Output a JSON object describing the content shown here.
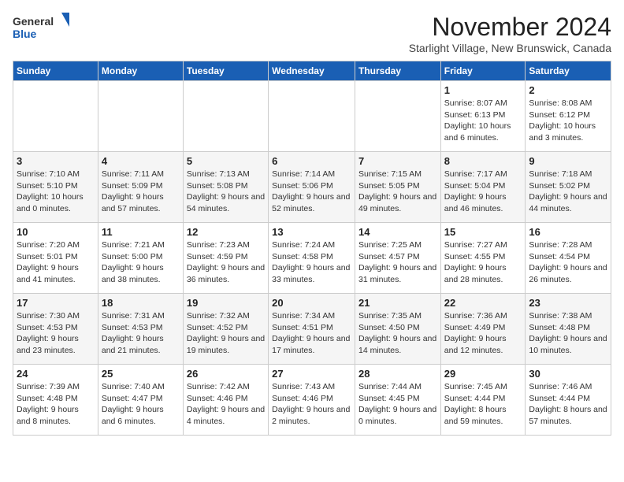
{
  "logo": {
    "line1": "General",
    "line2": "Blue"
  },
  "title": "November 2024",
  "subtitle": "Starlight Village, New Brunswick, Canada",
  "days_of_week": [
    "Sunday",
    "Monday",
    "Tuesday",
    "Wednesday",
    "Thursday",
    "Friday",
    "Saturday"
  ],
  "weeks": [
    [
      {
        "day": "",
        "detail": ""
      },
      {
        "day": "",
        "detail": ""
      },
      {
        "day": "",
        "detail": ""
      },
      {
        "day": "",
        "detail": ""
      },
      {
        "day": "",
        "detail": ""
      },
      {
        "day": "1",
        "detail": "Sunrise: 8:07 AM\nSunset: 6:13 PM\nDaylight: 10 hours and 6 minutes."
      },
      {
        "day": "2",
        "detail": "Sunrise: 8:08 AM\nSunset: 6:12 PM\nDaylight: 10 hours and 3 minutes."
      }
    ],
    [
      {
        "day": "3",
        "detail": "Sunrise: 7:10 AM\nSunset: 5:10 PM\nDaylight: 10 hours and 0 minutes."
      },
      {
        "day": "4",
        "detail": "Sunrise: 7:11 AM\nSunset: 5:09 PM\nDaylight: 9 hours and 57 minutes."
      },
      {
        "day": "5",
        "detail": "Sunrise: 7:13 AM\nSunset: 5:08 PM\nDaylight: 9 hours and 54 minutes."
      },
      {
        "day": "6",
        "detail": "Sunrise: 7:14 AM\nSunset: 5:06 PM\nDaylight: 9 hours and 52 minutes."
      },
      {
        "day": "7",
        "detail": "Sunrise: 7:15 AM\nSunset: 5:05 PM\nDaylight: 9 hours and 49 minutes."
      },
      {
        "day": "8",
        "detail": "Sunrise: 7:17 AM\nSunset: 5:04 PM\nDaylight: 9 hours and 46 minutes."
      },
      {
        "day": "9",
        "detail": "Sunrise: 7:18 AM\nSunset: 5:02 PM\nDaylight: 9 hours and 44 minutes."
      }
    ],
    [
      {
        "day": "10",
        "detail": "Sunrise: 7:20 AM\nSunset: 5:01 PM\nDaylight: 9 hours and 41 minutes."
      },
      {
        "day": "11",
        "detail": "Sunrise: 7:21 AM\nSunset: 5:00 PM\nDaylight: 9 hours and 38 minutes."
      },
      {
        "day": "12",
        "detail": "Sunrise: 7:23 AM\nSunset: 4:59 PM\nDaylight: 9 hours and 36 minutes."
      },
      {
        "day": "13",
        "detail": "Sunrise: 7:24 AM\nSunset: 4:58 PM\nDaylight: 9 hours and 33 minutes."
      },
      {
        "day": "14",
        "detail": "Sunrise: 7:25 AM\nSunset: 4:57 PM\nDaylight: 9 hours and 31 minutes."
      },
      {
        "day": "15",
        "detail": "Sunrise: 7:27 AM\nSunset: 4:55 PM\nDaylight: 9 hours and 28 minutes."
      },
      {
        "day": "16",
        "detail": "Sunrise: 7:28 AM\nSunset: 4:54 PM\nDaylight: 9 hours and 26 minutes."
      }
    ],
    [
      {
        "day": "17",
        "detail": "Sunrise: 7:30 AM\nSunset: 4:53 PM\nDaylight: 9 hours and 23 minutes."
      },
      {
        "day": "18",
        "detail": "Sunrise: 7:31 AM\nSunset: 4:53 PM\nDaylight: 9 hours and 21 minutes."
      },
      {
        "day": "19",
        "detail": "Sunrise: 7:32 AM\nSunset: 4:52 PM\nDaylight: 9 hours and 19 minutes."
      },
      {
        "day": "20",
        "detail": "Sunrise: 7:34 AM\nSunset: 4:51 PM\nDaylight: 9 hours and 17 minutes."
      },
      {
        "day": "21",
        "detail": "Sunrise: 7:35 AM\nSunset: 4:50 PM\nDaylight: 9 hours and 14 minutes."
      },
      {
        "day": "22",
        "detail": "Sunrise: 7:36 AM\nSunset: 4:49 PM\nDaylight: 9 hours and 12 minutes."
      },
      {
        "day": "23",
        "detail": "Sunrise: 7:38 AM\nSunset: 4:48 PM\nDaylight: 9 hours and 10 minutes."
      }
    ],
    [
      {
        "day": "24",
        "detail": "Sunrise: 7:39 AM\nSunset: 4:48 PM\nDaylight: 9 hours and 8 minutes."
      },
      {
        "day": "25",
        "detail": "Sunrise: 7:40 AM\nSunset: 4:47 PM\nDaylight: 9 hours and 6 minutes."
      },
      {
        "day": "26",
        "detail": "Sunrise: 7:42 AM\nSunset: 4:46 PM\nDaylight: 9 hours and 4 minutes."
      },
      {
        "day": "27",
        "detail": "Sunrise: 7:43 AM\nSunset: 4:46 PM\nDaylight: 9 hours and 2 minutes."
      },
      {
        "day": "28",
        "detail": "Sunrise: 7:44 AM\nSunset: 4:45 PM\nDaylight: 9 hours and 0 minutes."
      },
      {
        "day": "29",
        "detail": "Sunrise: 7:45 AM\nSunset: 4:44 PM\nDaylight: 8 hours and 59 minutes."
      },
      {
        "day": "30",
        "detail": "Sunrise: 7:46 AM\nSunset: 4:44 PM\nDaylight: 8 hours and 57 minutes."
      }
    ]
  ]
}
